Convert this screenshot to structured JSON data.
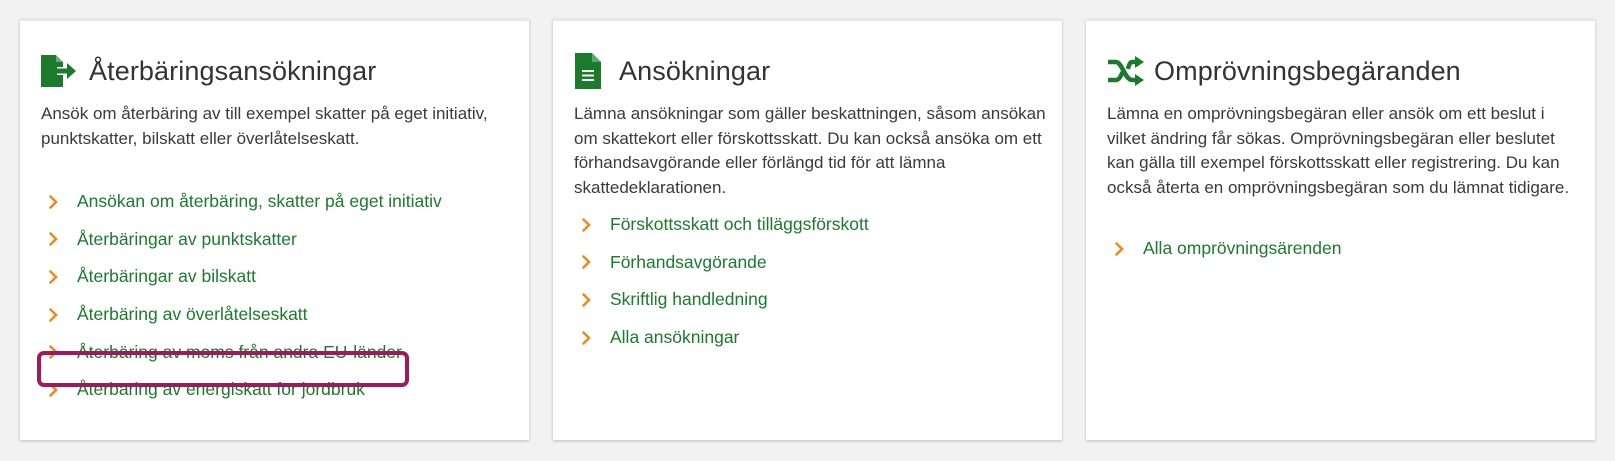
{
  "colors": {
    "accent_green": "#1b7a2c",
    "chevron_orange": "#ef8a1e",
    "highlight_border": "#a0185e",
    "background": "#f2f2f2"
  },
  "cards": [
    {
      "icon": "file-export-icon",
      "title": "Återbäringsansökningar",
      "description": "Ansök om återbäring av till exempel skatter på eget initiativ, punktskatter, bilskatt eller överlåtelseskatt.",
      "links": [
        "Ansökan om återbäring, skatter på eget initiativ",
        "Återbäringar av punktskatter",
        "Återbäringar av bilskatt",
        "Återbäring av överlåtelseskatt",
        "Återbäring av moms från andra EU-länder",
        "Återbäring av energiskatt för jordbruk"
      ]
    },
    {
      "icon": "document-icon",
      "title": "Ansökningar",
      "description": "Lämna ansökningar som gäller beskattningen, såsom ansökan om skattekort eller förskottsskatt. Du kan också ansöka om ett förhandsavgörande eller förlängd tid för att lämna skattedeklarationen.",
      "links": [
        "Förskottsskatt och tilläggsförskott",
        "Förhandsavgörande",
        "Skriftlig handledning",
        "Alla ansökningar"
      ]
    },
    {
      "icon": "shuffle-icon",
      "title": "Omprövningsbegäranden",
      "description": "Lämna en omprövningsbegäran eller ansök om ett beslut i vilket ändring får sökas. Omprövningsbegäran eller beslutet kan gälla till exempel förskottsskatt eller registrering. Du kan också återta en omprövningsbegäran som du lämnat tidigare.",
      "links": [
        "Alla omprövningsärenden"
      ]
    }
  ]
}
